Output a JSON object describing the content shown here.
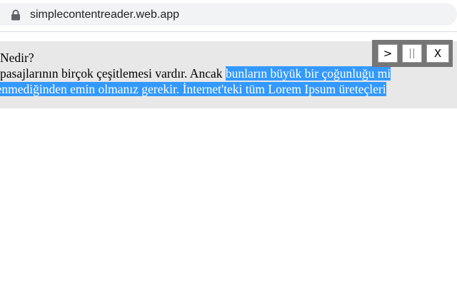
{
  "browser": {
    "url": "simplecontentreader.web.app"
  },
  "reader": {
    "heading": "m Nedir?",
    "line2_plain": "m pasajlarının birçok çeşitlemesi vardır. Ancak ",
    "line2_highlighted": "bunların büyük bir çoğunluğu mi",
    "line3_highlighted": "zlenmediğinden emin olmanız gerekir. İnternet'teki tüm Lorem Ipsum üreteçleri"
  },
  "controls": {
    "play_label": ">",
    "pause_label": "||",
    "close_label": "X"
  },
  "colors": {
    "highlight": "#3399ff",
    "panel_background": "#e8e8e8",
    "controls_background": "#767676"
  }
}
